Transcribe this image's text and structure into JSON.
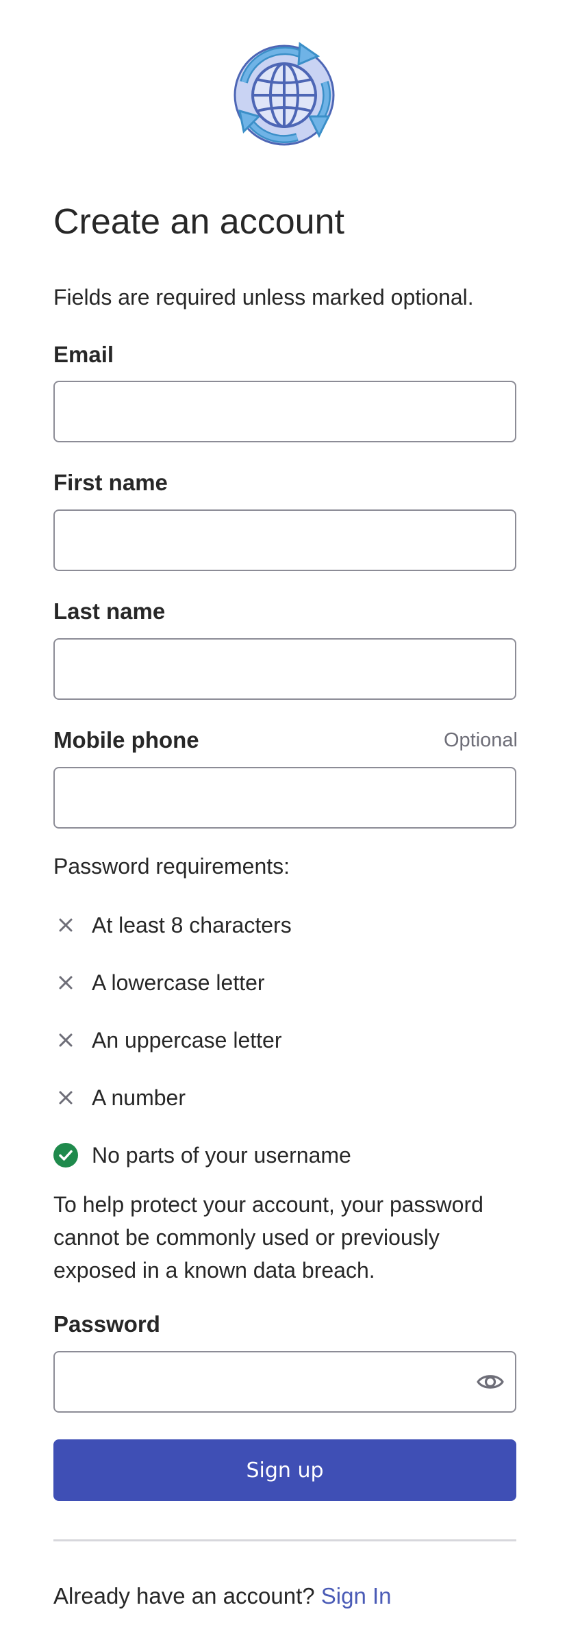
{
  "form": {
    "title": "Create an account",
    "intro": "Fields are required unless marked optional.",
    "fields": {
      "email": {
        "label": "Email",
        "value": ""
      },
      "first_name": {
        "label": "First name",
        "value": ""
      },
      "last_name": {
        "label": "Last name",
        "value": ""
      },
      "mobile_phone": {
        "label": "Mobile phone",
        "optional_tag": "Optional",
        "value": ""
      },
      "password": {
        "label": "Password",
        "value": ""
      }
    },
    "requirements": {
      "heading": "Password requirements:",
      "items": [
        {
          "text": "At least 8 characters",
          "status": "unmet",
          "icon": "close-icon"
        },
        {
          "text": "A lowercase letter",
          "status": "unmet",
          "icon": "close-icon"
        },
        {
          "text": "An uppercase letter",
          "status": "unmet",
          "icon": "close-icon"
        },
        {
          "text": "A number",
          "status": "unmet",
          "icon": "close-icon"
        },
        {
          "text": "No parts of your username",
          "status": "met",
          "icon": "check-circle-icon"
        }
      ]
    },
    "help_text": "To help protect your account, your password cannot be commonly used or previously exposed in a known data breach.",
    "password_toggle_icon": "eye-icon",
    "submit_label": "Sign up",
    "footer": {
      "prompt": "Already have an account?",
      "link_label": "Sign In"
    }
  },
  "logo_icon": "globe-refresh-icon",
  "colors": {
    "primary_button": "#3f4fb5",
    "link": "#4a5bb6",
    "success": "#1f8a4c",
    "unmet_icon": "#6e6e78",
    "text": "#272727"
  }
}
